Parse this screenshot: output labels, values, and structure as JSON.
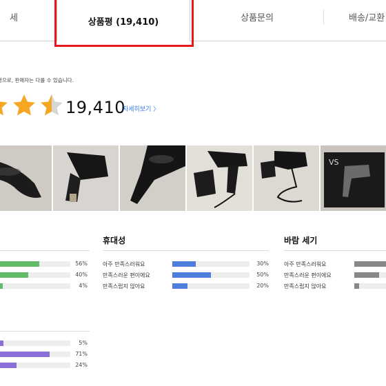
{
  "tabs": {
    "detail": "세",
    "review": "상품평 (19,410)",
    "qna": "상품문의",
    "shipping": "배송/교환"
  },
  "notice": "평으로, 판매자는 다를 수 있습니다.",
  "rating": {
    "stars_filled": 4.5,
    "count": "19,410",
    "more_label": "자세히보기",
    "more_icon": "chevron-right-icon"
  },
  "photos": [
    "hair-dryer-photo-1",
    "hair-dryer-photo-2",
    "hair-dryer-photo-3",
    "hair-dryer-photo-4",
    "hair-dryer-photo-5",
    "hair-dryer-photo-6"
  ],
  "photo_brand_text": "VS",
  "survey_left_top": {
    "rows": [
      {
        "label": "",
        "pct": "56%",
        "value": 0.56
      },
      {
        "label": "",
        "pct": "40%",
        "value": 0.4
      },
      {
        "label": "",
        "pct": "4%",
        "value": 0.04
      }
    ],
    "color": "#66bb6a"
  },
  "survey_portability": {
    "title": "휴대성",
    "rows": [
      {
        "label": "아주 만족스러워요",
        "pct": "30%",
        "value": 0.3
      },
      {
        "label": "만족스러운 편이에요",
        "pct": "50%",
        "value": 0.5
      },
      {
        "label": "만족스럽지 않아요",
        "pct": "20%",
        "value": 0.2
      }
    ],
    "color": "#4f7ddc"
  },
  "survey_wind": {
    "title": "바람 세기",
    "rows": [
      {
        "label": "아주 만족스러워요",
        "value": 0.8
      },
      {
        "label": "만족스러운 편이에요",
        "value": 0.6
      },
      {
        "label": "만족스럽지 않아요",
        "value": 0.12
      }
    ],
    "color": "#888888"
  },
  "survey_left_bottom": {
    "rows": [
      {
        "label": "",
        "pct": "5%",
        "value": 0.05
      },
      {
        "label": "",
        "pct": "71%",
        "value": 0.71
      },
      {
        "label": "",
        "pct": "24%",
        "value": 0.24
      }
    ],
    "color": "#8a6fd8"
  }
}
